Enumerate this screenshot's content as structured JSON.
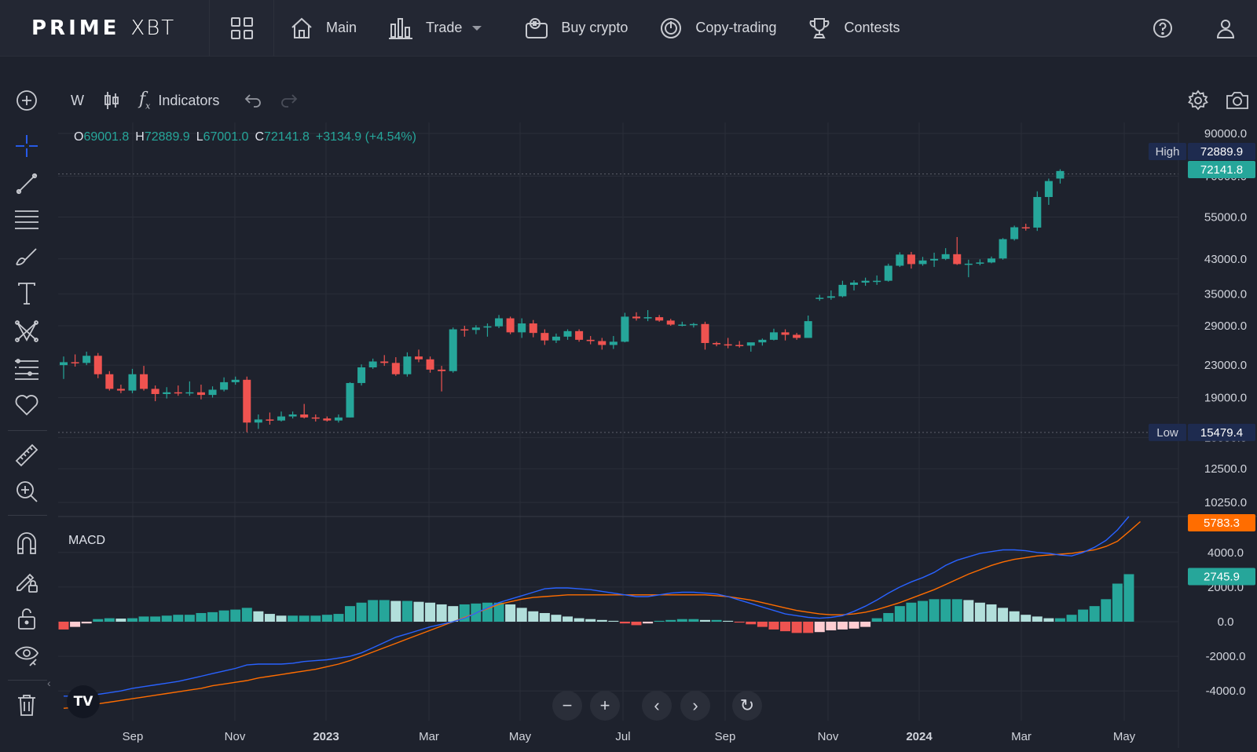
{
  "app": {
    "logo_main": "PRIME",
    "logo_sub": "XBT"
  },
  "nav": {
    "items": [
      {
        "label": "Main",
        "icon": "home-icon"
      },
      {
        "label": "Trade",
        "icon": "bar-chart-icon",
        "dropdown": true
      },
      {
        "label": "Buy crypto",
        "icon": "wallet-crypto-icon"
      },
      {
        "label": "Copy-trading",
        "icon": "copy-signal-icon"
      },
      {
        "label": "Contests",
        "icon": "trophy-icon"
      }
    ],
    "right_icons": [
      "help-icon",
      "user-icon"
    ]
  },
  "toolbar": {
    "interval": "W",
    "indicators_label": "Indicators",
    "icons": [
      "add-circle-icon",
      "candle-type-icon",
      "fx-icon",
      "undo-icon",
      "redo-icon",
      "settings-icon",
      "camera-icon"
    ]
  },
  "left_tools": [
    "crosshair-icon",
    "trend-line-icon",
    "horizontal-lines-icon",
    "brush-icon",
    "text-icon",
    "pattern-icon",
    "fib-icon",
    "favorite-icon",
    "ruler-icon",
    "zoom-in-icon",
    "magnet-icon",
    "lock-drawing-icon",
    "lock-icon",
    "eye-icon",
    "trash-icon"
  ],
  "ohlc": {
    "o_key": "O",
    "o_val": "69001.8",
    "h_key": "H",
    "h_val": "72889.9",
    "l_key": "L",
    "l_val": "67001.0",
    "c_key": "C",
    "c_val": "72141.8",
    "change": "+3134.9 (+4.54%)"
  },
  "macd_label": "MACD",
  "colors": {
    "up": "#26a69a",
    "down": "#ef5350",
    "up_hist_light": "#b2dfdb",
    "down_hist_light": "#ffcdd2",
    "macd_line": "#2962ff",
    "signal_line": "#ff6d00",
    "background": "#1e222d"
  },
  "chart_data": {
    "type": "candlestick",
    "interval": "weekly",
    "price_axis": [
      "90000.0",
      "70000.0",
      "55000.0",
      "43000.0",
      "35000.0",
      "29000.0",
      "23000.0",
      "19000.0",
      "15000.0",
      "12500.0",
      "10250.0"
    ],
    "price_scale": "log",
    "markers": [
      {
        "label": "High",
        "value": "72889.9"
      },
      {
        "label": "",
        "value": "72141.8"
      },
      {
        "label": "Low",
        "value": "15479.4"
      }
    ],
    "x_ticks": [
      "Sep",
      "Nov",
      "2023",
      "Mar",
      "May",
      "Jul",
      "Sep",
      "Nov",
      "2024",
      "Mar",
      "May"
    ],
    "candles_ohlc": [
      [
        23000,
        24200,
        21200,
        23400
      ],
      [
        23400,
        24500,
        22800,
        23300
      ],
      [
        23300,
        24900,
        23000,
        24300
      ],
      [
        24300,
        24700,
        21300,
        21800
      ],
      [
        21800,
        22200,
        19800,
        20000
      ],
      [
        20000,
        20500,
        19500,
        19800
      ],
      [
        19800,
        22500,
        19500,
        21800
      ],
      [
        21800,
        22900,
        19800,
        20000
      ],
      [
        20000,
        20400,
        18600,
        19400
      ],
      [
        19400,
        20200,
        18900,
        19600
      ],
      [
        19600,
        20400,
        19200,
        19500
      ],
      [
        19500,
        20900,
        19200,
        19600
      ],
      [
        19600,
        20500,
        18800,
        19300
      ],
      [
        19300,
        20300,
        19000,
        19900
      ],
      [
        19900,
        21400,
        19700,
        20800
      ],
      [
        20800,
        21500,
        20500,
        21100
      ],
      [
        21100,
        21500,
        15500,
        16400
      ],
      [
        16400,
        17200,
        15800,
        16700
      ],
      [
        16700,
        17400,
        16200,
        16600
      ],
      [
        16600,
        17500,
        16500,
        17000
      ],
      [
        17000,
        17500,
        16800,
        17200
      ],
      [
        17200,
        18300,
        16800,
        16900
      ],
      [
        16900,
        17200,
        16500,
        16800
      ],
      [
        16800,
        17000,
        16500,
        16600
      ],
      [
        16600,
        17200,
        16400,
        16900
      ],
      [
        16900,
        20800,
        16900,
        20700
      ],
      [
        20700,
        23100,
        20400,
        22700
      ],
      [
        22700,
        23900,
        22500,
        23500
      ],
      [
        23500,
        24400,
        22900,
        23300
      ],
      [
        23300,
        24100,
        21600,
        21800
      ],
      [
        21800,
        24800,
        21500,
        24200
      ],
      [
        24200,
        25200,
        23400,
        23800
      ],
      [
        23800,
        24200,
        22000,
        22400
      ],
      [
        22400,
        22900,
        19700,
        22200
      ],
      [
        22200,
        28700,
        22000,
        28400
      ],
      [
        28400,
        29000,
        27200,
        28300
      ],
      [
        28300,
        29100,
        27600,
        28700
      ],
      [
        28700,
        29400,
        27200,
        28900
      ],
      [
        28900,
        30900,
        28600,
        30300
      ],
      [
        30300,
        30600,
        27600,
        27900
      ],
      [
        27900,
        30300,
        27000,
        29400
      ],
      [
        29400,
        30000,
        27100,
        27800
      ],
      [
        27800,
        28400,
        25900,
        26600
      ],
      [
        26600,
        27700,
        26200,
        27200
      ],
      [
        27200,
        28400,
        26700,
        28100
      ],
      [
        28100,
        28400,
        26400,
        26700
      ],
      [
        26700,
        27300,
        26000,
        26500
      ],
      [
        26500,
        27000,
        25200,
        25900
      ],
      [
        25900,
        27300,
        25300,
        26400
      ],
      [
        26400,
        31300,
        26300,
        30600
      ],
      [
        30600,
        31400,
        29900,
        30300
      ],
      [
        30300,
        31800,
        29800,
        30500
      ],
      [
        30500,
        30900,
        29700,
        29900
      ],
      [
        29900,
        30200,
        29000,
        29200
      ],
      [
        29200,
        29700,
        28900,
        29200
      ],
      [
        29200,
        29500,
        28700,
        29300
      ],
      [
        29300,
        29700,
        25200,
        26200
      ],
      [
        26200,
        26400,
        25700,
        26000
      ],
      [
        26000,
        27000,
        25400,
        25900
      ],
      [
        25900,
        26500,
        25500,
        25800
      ],
      [
        25800,
        26200,
        24900,
        26300
      ],
      [
        26300,
        26900,
        25800,
        26700
      ],
      [
        26700,
        28500,
        26600,
        27900
      ],
      [
        27900,
        28400,
        26600,
        27500
      ],
      [
        27500,
        27800,
        26700,
        27000
      ],
      [
        27000,
        30800,
        27000,
        29800
      ],
      [
        34000,
        34800,
        33600,
        34200
      ],
      [
        34200,
        35700,
        33800,
        34500
      ],
      [
        34500,
        37800,
        34300,
        36900
      ],
      [
        36900,
        37900,
        35700,
        37400
      ],
      [
        37400,
        38500,
        36700,
        37800
      ],
      [
        37800,
        39000,
        36900,
        37800
      ],
      [
        37800,
        41800,
        37600,
        41300
      ],
      [
        41300,
        44700,
        41000,
        44100
      ],
      [
        44100,
        44800,
        40600,
        41700
      ],
      [
        41700,
        43500,
        41300,
        42600
      ],
      [
        42600,
        44600,
        41000,
        43000
      ],
      [
        43000,
        45800,
        42700,
        44200
      ],
      [
        44200,
        48900,
        41500,
        41700
      ],
      [
        41700,
        42800,
        38600,
        41800
      ],
      [
        41800,
        42900,
        41400,
        42100
      ],
      [
        42100,
        43600,
        41900,
        43100
      ],
      [
        43100,
        48600,
        42800,
        48300
      ],
      [
        48300,
        52300,
        47900,
        51800
      ],
      [
        51800,
        52900,
        50800,
        51700
      ],
      [
        51700,
        64000,
        50700,
        61900
      ],
      [
        61900,
        69000,
        59100,
        68000
      ],
      [
        69001.8,
        72889.9,
        67001.0,
        72141.8
      ]
    ],
    "macd": {
      "axis": [
        "5783.3",
        "4000.0",
        "2745.9",
        "2000.0",
        "0.0",
        "-2000.0",
        "-4000.0"
      ],
      "markers": [
        {
          "value": "5783.3",
          "series": "signal"
        },
        {
          "value": "2745.9",
          "series": "histogram"
        }
      ],
      "macd_line": [
        -4300,
        -4300,
        -4300,
        -4200,
        -4100,
        -4000,
        -3850,
        -3750,
        -3650,
        -3550,
        -3450,
        -3300,
        -3150,
        -3000,
        -2850,
        -2700,
        -2500,
        -2450,
        -2450,
        -2450,
        -2400,
        -2300,
        -2250,
        -2200,
        -2100,
        -2000,
        -1800,
        -1500,
        -1200,
        -900,
        -700,
        -500,
        -300,
        -150,
        0,
        200,
        500,
        800,
        1100,
        1300,
        1500,
        1700,
        1900,
        1950,
        1950,
        1900,
        1850,
        1750,
        1650,
        1550,
        1450,
        1450,
        1550,
        1650,
        1700,
        1700,
        1650,
        1600,
        1450,
        1250,
        1050,
        850,
        650,
        450,
        350,
        250,
        200,
        250,
        350,
        600,
        900,
        1250,
        1650,
        2000,
        2300,
        2550,
        2850,
        3250,
        3550,
        3750,
        3950,
        4050,
        4150,
        4150,
        4100,
        4000,
        3950,
        3850,
        3800,
        4000,
        4300,
        4700,
        5300,
        6500
      ],
      "signal_line": [
        -5000,
        -4950,
        -4850,
        -4750,
        -4650,
        -4550,
        -4450,
        -4350,
        -4250,
        -4150,
        -4050,
        -3950,
        -3850,
        -3700,
        -3600,
        -3500,
        -3400,
        -3250,
        -3150,
        -3050,
        -2950,
        -2850,
        -2750,
        -2600,
        -2450,
        -2250,
        -2000,
        -1750,
        -1500,
        -1250,
        -1000,
        -750,
        -500,
        -250,
        0,
        250,
        500,
        750,
        1000,
        1150,
        1300,
        1400,
        1450,
        1500,
        1550,
        1550,
        1550,
        1550,
        1550,
        1550,
        1550,
        1550,
        1550,
        1550,
        1550,
        1550,
        1550,
        1500,
        1450,
        1350,
        1250,
        1100,
        950,
        800,
        650,
        550,
        450,
        400,
        400,
        450,
        550,
        700,
        900,
        1100,
        1350,
        1600,
        1850,
        2150,
        2450,
        2750,
        3000,
        3250,
        3450,
        3600,
        3700,
        3800,
        3850,
        3900,
        3950,
        4050,
        4150,
        4350,
        4650,
        5200,
        5783.3
      ],
      "histogram": [
        -450,
        -300,
        -100,
        150,
        200,
        180,
        200,
        300,
        300,
        350,
        400,
        400,
        500,
        550,
        650,
        700,
        800,
        600,
        450,
        350,
        350,
        350,
        350,
        400,
        450,
        900,
        1100,
        1250,
        1250,
        1200,
        1200,
        1150,
        1100,
        1000,
        900,
        1000,
        1050,
        1100,
        1100,
        1000,
        800,
        600,
        500,
        400,
        300,
        200,
        150,
        100,
        50,
        -100,
        -200,
        -100,
        50,
        100,
        150,
        150,
        100,
        100,
        50,
        -50,
        -150,
        -300,
        -450,
        -550,
        -650,
        -650,
        -600,
        -500,
        -450,
        -400,
        -300,
        200,
        500,
        900,
        1100,
        1200,
        1300,
        1300,
        1300,
        1250,
        1100,
        1000,
        800,
        600,
        400,
        300,
        200,
        200,
        400,
        700,
        900,
        1300,
        2200,
        2745.9
      ]
    }
  }
}
